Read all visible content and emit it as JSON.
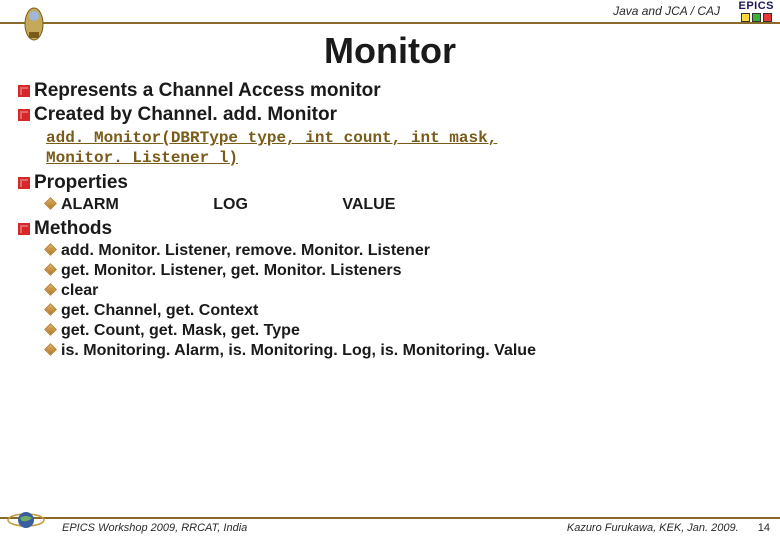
{
  "header": {
    "subject": "Java and JCA / CAJ",
    "logo_text": "EPICS"
  },
  "title": "Monitor",
  "bullets": {
    "b1": "Represents a Channel Access monitor",
    "b2": "Created by Channel. add. Monitor",
    "code_l1": "add. Monitor(DBRType type, int count, int mask,",
    "code_l2": "  Monitor. Listener l)",
    "b3": "Properties",
    "props": {
      "p1": "ALARM",
      "p2": "LOG",
      "p3": "VALUE"
    },
    "b4": "Methods",
    "methods": {
      "m1": "add. Monitor. Listener, remove. Monitor. Listener",
      "m2": "get. Monitor. Listener, get. Monitor. Listeners",
      "m3": "clear",
      "m4": "get. Channel, get. Context",
      "m5": "get. Count, get. Mask, get. Type",
      "m6": "is. Monitoring. Alarm, is. Monitoring. Log, is. Monitoring. Value"
    }
  },
  "footer": {
    "left": "EPICS Workshop 2009, RRCAT, India",
    "right": "Kazuro Furukawa, KEK, Jan. 2009.",
    "page": "14"
  }
}
